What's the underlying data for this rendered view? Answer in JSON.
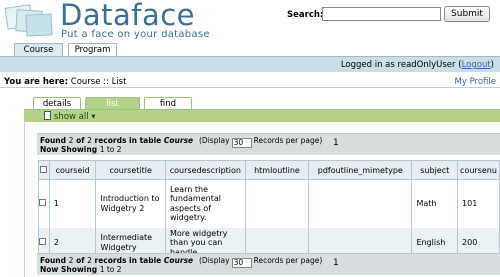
{
  "header": {
    "logo_text": "Dataface",
    "tagline": "Put a face on your database",
    "search_label": "Search:",
    "search_value": "",
    "search_button": "Submit"
  },
  "top_tabs": [
    {
      "label": "Course",
      "active": true
    },
    {
      "label": "Program",
      "active": false
    }
  ],
  "login": {
    "prefix": "Logged in as ",
    "user": "readOnlyUser",
    "open_paren": " (",
    "logout": "Logout",
    "close_paren": ")"
  },
  "breadcrumb": {
    "label": "You are here:",
    "path": " Course :: List"
  },
  "my_profile": "My Profile",
  "sub_tabs": [
    {
      "label": "details",
      "active": false
    },
    {
      "label": "list",
      "active": true
    },
    {
      "label": "find",
      "active": false
    }
  ],
  "show_all": "show all",
  "results": {
    "found_word": "Found",
    "found_count": "2",
    "of_word": "of",
    "total": "2",
    "records_in_table": "records in table",
    "table_name": "Course",
    "now_showing": "Now Showing",
    "range": "1 to 2",
    "display_label": "(Display",
    "display_value": "30",
    "records_per_page": "Records per page)",
    "page": "1"
  },
  "table": {
    "columns": [
      "courseid",
      "coursetitle",
      "coursedescription",
      "htmloutline",
      "pdfoutline_mimetype",
      "subject",
      "coursenu"
    ],
    "rows": [
      [
        "1",
        "Introduction to Widgetry 2",
        "Learn the fundamental aspects of widgetry.",
        "",
        "",
        "Math",
        "101"
      ],
      [
        "2",
        "Intermediate Widgetry",
        "More widgetry than you can handle.",
        "",
        "",
        "English",
        "200"
      ]
    ]
  },
  "colors": {
    "brand_blue": "#3b6f96",
    "login_bar": "#c7dfe6",
    "green_bar": "#b3d289",
    "result_bar": "#d8dde0"
  }
}
